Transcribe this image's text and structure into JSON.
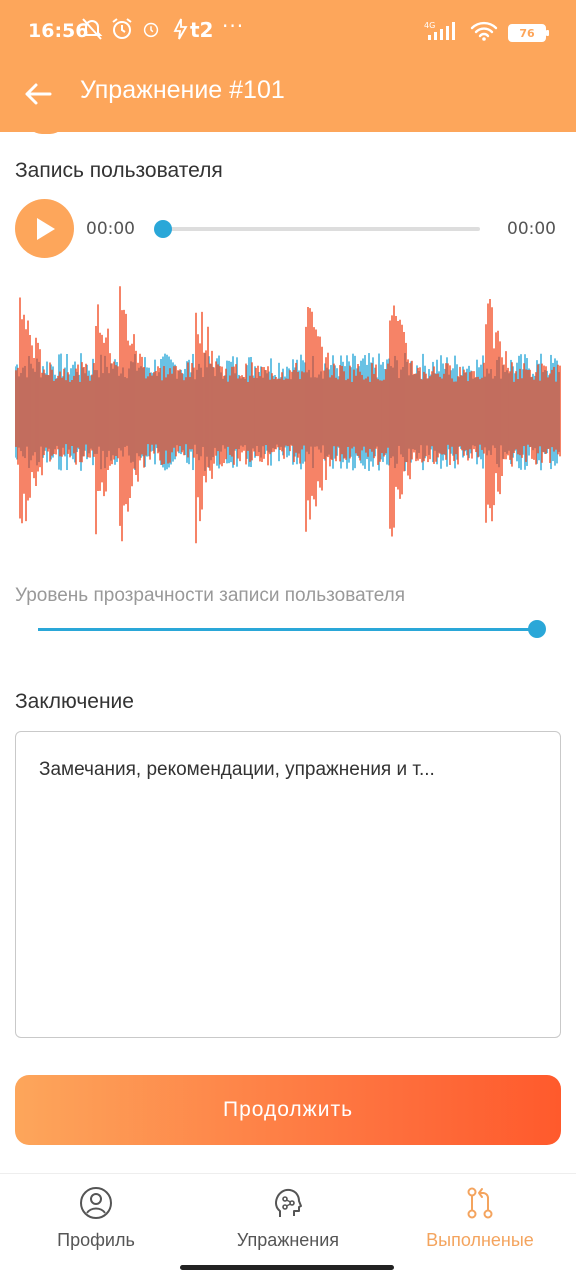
{
  "status_bar": {
    "time": "16:56",
    "carrier": "t2",
    "more": "···",
    "network": "4G",
    "battery": "76"
  },
  "app_bar": {
    "title": "Упражнение #101",
    "back_icon": "arrow-left-icon"
  },
  "player": {
    "section_label": "Запись пользователя",
    "current_time": "00:00",
    "total_time": "00:00",
    "progress": 0,
    "play_icon": "play-icon"
  },
  "waveform": {
    "reference_color": "#2aa7d8",
    "user_color": "#f45a35"
  },
  "opacity": {
    "label": "Уровень прозрачности записи пользователя",
    "value": 1.0
  },
  "conclusion": {
    "label": "Заключение",
    "placeholder": "Замечания, рекомендации, упражнения и т..."
  },
  "continue_button": {
    "label": "Продолжить"
  },
  "bottom_nav": {
    "items": [
      {
        "label": "Профиль",
        "icon": "profile-icon",
        "active": false
      },
      {
        "label": "Упражнения",
        "icon": "exercises-head-icon",
        "active": false
      },
      {
        "label": "Выполненые",
        "icon": "completed-icon",
        "active": true
      }
    ]
  },
  "colors": {
    "accent": "#fda65b",
    "slider": "#2aa7d8",
    "button_gradient_end": "#ff5a2c"
  }
}
